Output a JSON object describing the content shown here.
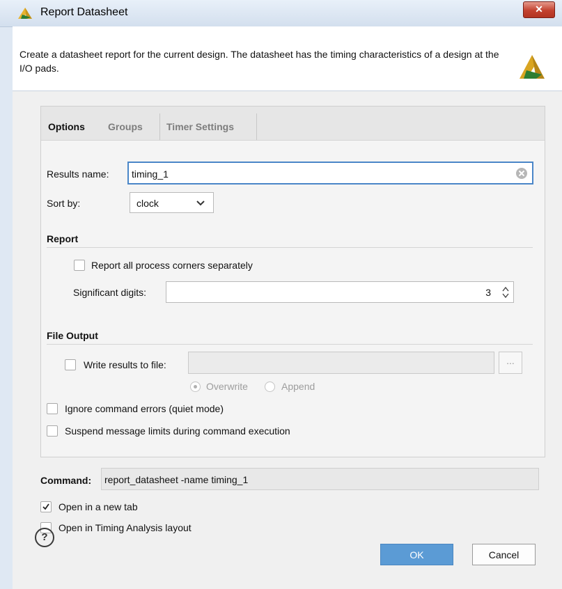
{
  "window": {
    "title": "Report Datasheet",
    "close_label": "✕"
  },
  "description": "Create a datasheet report for the current design. The datasheet has the timing characteristics of a design at the I/O pads.",
  "tabs": [
    {
      "label": "Options",
      "active": true
    },
    {
      "label": "Groups",
      "active": false
    },
    {
      "label": "Timer Settings",
      "active": false
    }
  ],
  "options": {
    "results_name_label": "Results name:",
    "results_name_value": "timing_1",
    "sort_by_label": "Sort by:",
    "sort_by_value": "clock"
  },
  "report": {
    "title": "Report",
    "process_corners_label": "Report all process corners separately",
    "process_corners_checked": false,
    "sig_digits_label": "Significant digits:",
    "sig_digits_value": "3"
  },
  "file_output": {
    "title": "File Output",
    "write_label": "Write results to file:",
    "write_checked": false,
    "file_path": "",
    "browse_label": "...",
    "overwrite_label": "Overwrite",
    "append_label": "Append",
    "selected_mode": "Overwrite"
  },
  "flags": {
    "ignore_errors_label": "Ignore command errors (quiet mode)",
    "ignore_errors_checked": false,
    "suspend_limits_label": "Suspend message limits during command execution",
    "suspend_limits_checked": false
  },
  "command": {
    "label": "Command:",
    "value": "report_datasheet -name timing_1"
  },
  "open_new_tab": {
    "label": "Open in a new tab",
    "checked": true
  },
  "open_timing_layout": {
    "label": "Open in Timing Analysis layout",
    "checked": false
  },
  "buttons": {
    "ok": "OK",
    "cancel": "Cancel",
    "help": "?"
  },
  "colors": {
    "accent": "#5b9bd5",
    "focus_border": "#4a86c8",
    "logo": "#d9a521"
  },
  "icons": {
    "app": "vivado-logo-icon",
    "close": "close-icon",
    "help": "help-icon",
    "clear": "clear-icon"
  }
}
